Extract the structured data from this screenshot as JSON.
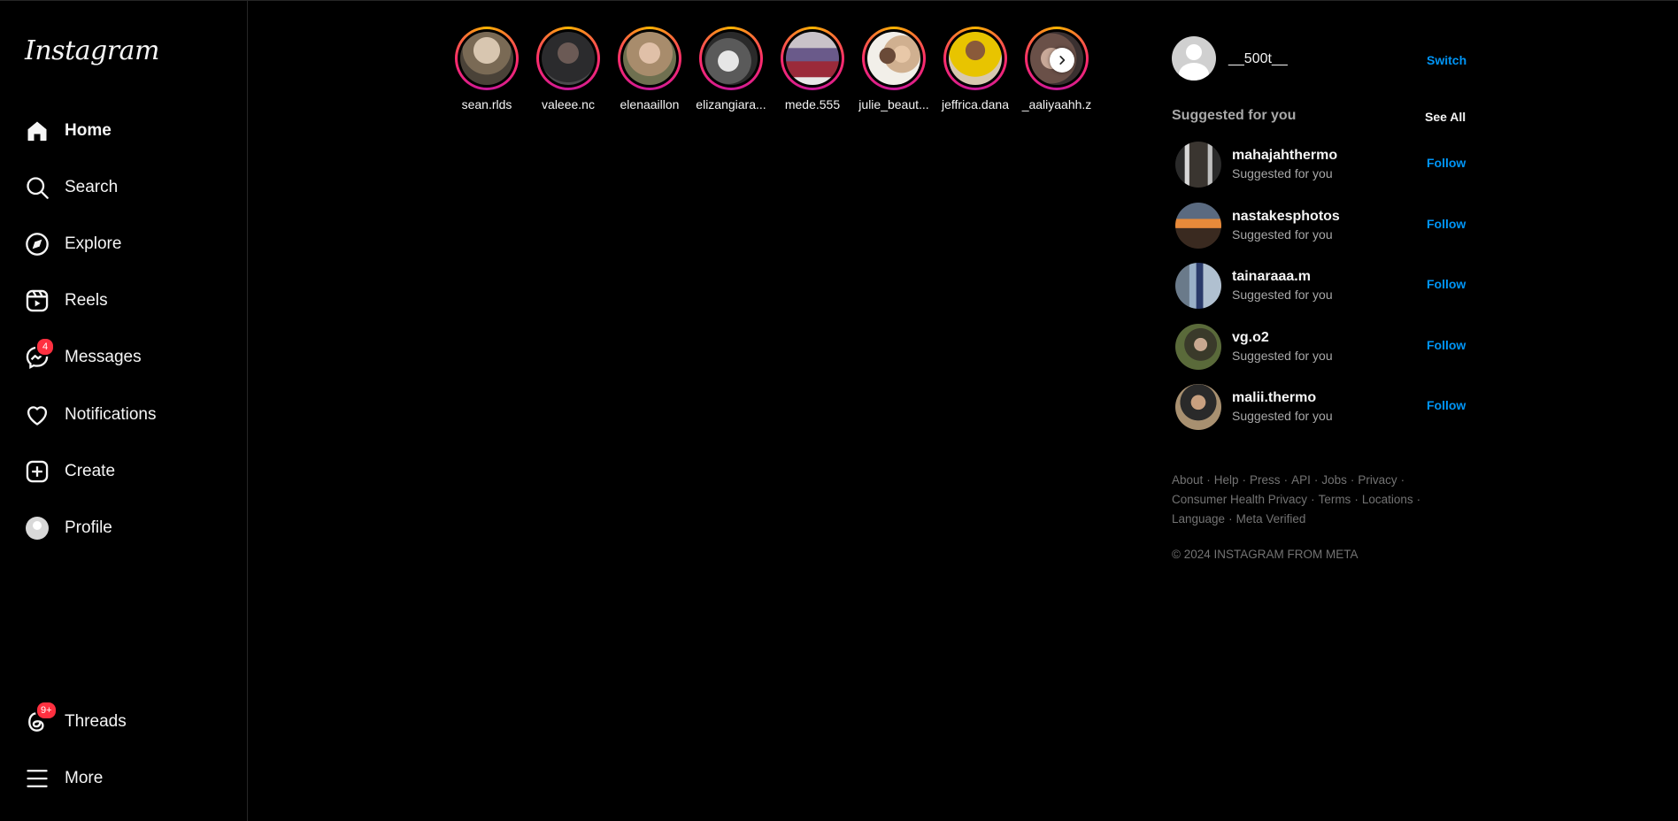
{
  "sidebar": {
    "logo": "Instagram",
    "items": [
      {
        "label": "Home",
        "icon": "home-icon"
      },
      {
        "label": "Search",
        "icon": "search-icon"
      },
      {
        "label": "Explore",
        "icon": "compass-icon"
      },
      {
        "label": "Reels",
        "icon": "reels-icon"
      },
      {
        "label": "Messages",
        "icon": "messenger-icon",
        "badge": "4"
      },
      {
        "label": "Notifications",
        "icon": "heart-icon"
      },
      {
        "label": "Create",
        "icon": "plus-square-icon"
      },
      {
        "label": "Profile",
        "icon": "avatar"
      }
    ],
    "bottom": [
      {
        "label": "Threads",
        "icon": "threads-icon",
        "badge": "9+"
      },
      {
        "label": "More",
        "icon": "hamburger-icon"
      }
    ]
  },
  "stories": [
    {
      "username": "sean.rlds"
    },
    {
      "username": "valeee.nc"
    },
    {
      "username": "elenaaillon"
    },
    {
      "username": "elizangiara..."
    },
    {
      "username": "mede.555"
    },
    {
      "username": "julie_beaut..."
    },
    {
      "username": "jeffrica.dana"
    },
    {
      "username": "_aaliyaahh.z"
    }
  ],
  "account": {
    "username": "__500t__",
    "switch_label": "Switch"
  },
  "suggestions": {
    "title": "Suggested for you",
    "see_all": "See All",
    "follow_label": "Follow",
    "items": [
      {
        "username": "mahajahthermo",
        "subtitle": "Suggested for you"
      },
      {
        "username": "nastakesphotos",
        "subtitle": "Suggested for you"
      },
      {
        "username": "tainaraaa.m",
        "subtitle": "Suggested for you"
      },
      {
        "username": "vg.o2",
        "subtitle": "Suggested for you"
      },
      {
        "username": "malii.thermo",
        "subtitle": "Suggested for you"
      }
    ]
  },
  "footer": {
    "links": [
      "About",
      "Help",
      "Press",
      "API",
      "Jobs",
      "Privacy",
      "Consumer Health Privacy",
      "Terms",
      "Locations",
      "Language",
      "Meta Verified"
    ],
    "copyright": "© 2024 INSTAGRAM FROM META"
  },
  "colors": {
    "background": "#000000",
    "accent": "#0095f6",
    "badge": "#ff3040",
    "muted": "#a8a8a8"
  }
}
